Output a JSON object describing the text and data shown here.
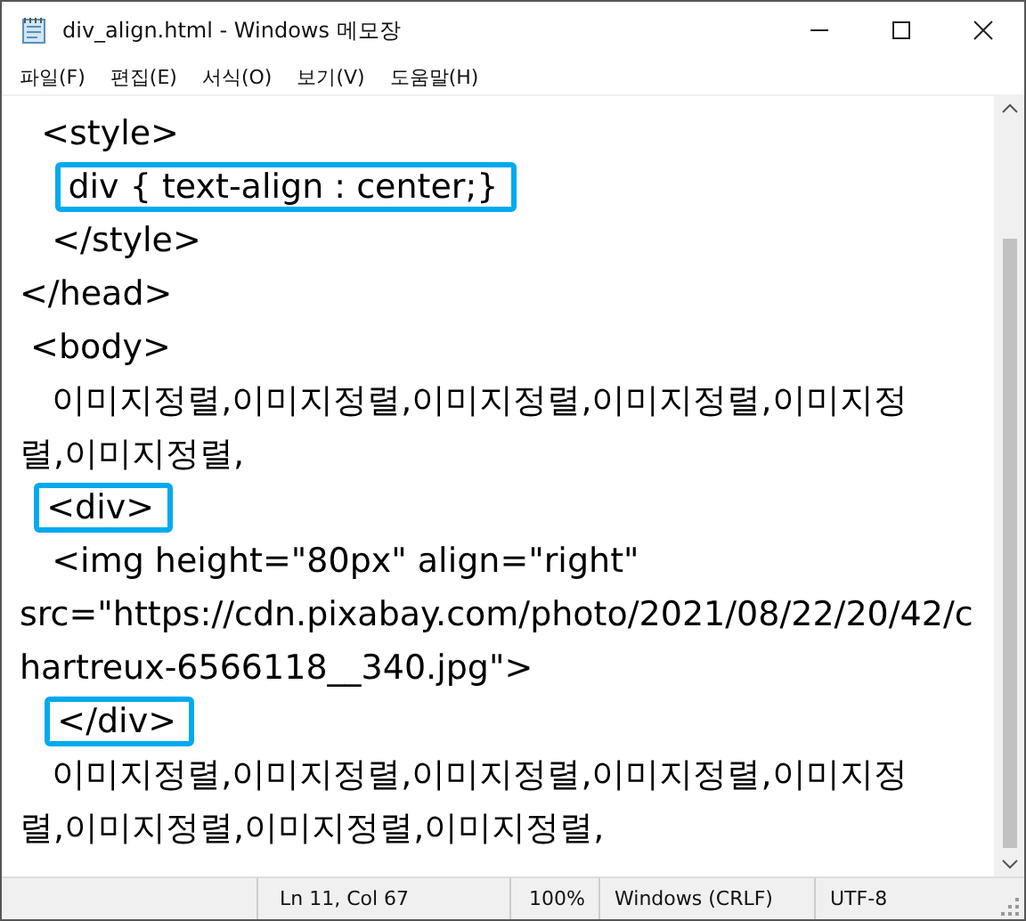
{
  "window": {
    "title": "div_align.html - Windows 메모장"
  },
  "menu": [
    {
      "label": "파일(F)"
    },
    {
      "label": "편집(E)"
    },
    {
      "label": "서식(O)"
    },
    {
      "label": "보기(V)"
    },
    {
      "label": "도움말(H)"
    }
  ],
  "editor": {
    "lines": [
      {
        "text": "  <style>",
        "highlighted": false
      },
      {
        "text": "     div { text-align : center;}",
        "highlighted": true
      },
      {
        "text": "   </style>",
        "highlighted": false
      },
      {
        "text": "</head>",
        "highlighted": false
      },
      {
        "text": " <body>",
        "highlighted": false
      },
      {
        "text": "   이미지정렬,이미지정렬,이미지정렬,이미지정렬,이미지정",
        "highlighted": false
      },
      {
        "text": "렬,이미지정렬,",
        "highlighted": false
      },
      {
        "text": "   <div>",
        "highlighted": true
      },
      {
        "text": "   <img height=\"80px\" align=\"right\"",
        "highlighted": false
      },
      {
        "text": "src=\"https://cdn.pixabay.com/photo/2021/08/22/20/42/c",
        "highlighted": false
      },
      {
        "text": "hartreux-6566118__340.jpg\">",
        "highlighted": false
      },
      {
        "text": "    </div>",
        "highlighted": true
      },
      {
        "text": "   이미지정렬,이미지정렬,이미지정렬,이미지정렬,이미지정",
        "highlighted": false
      },
      {
        "text": "렬,이미지정렬,이미지정렬,이미지정렬,",
        "highlighted": false
      }
    ]
  },
  "status_bar": [
    {
      "text": "Ln 11, Col 67"
    },
    {
      "text": "100%"
    },
    {
      "text": "Windows (CRLF)"
    },
    {
      "text": "UTF-8"
    }
  ]
}
